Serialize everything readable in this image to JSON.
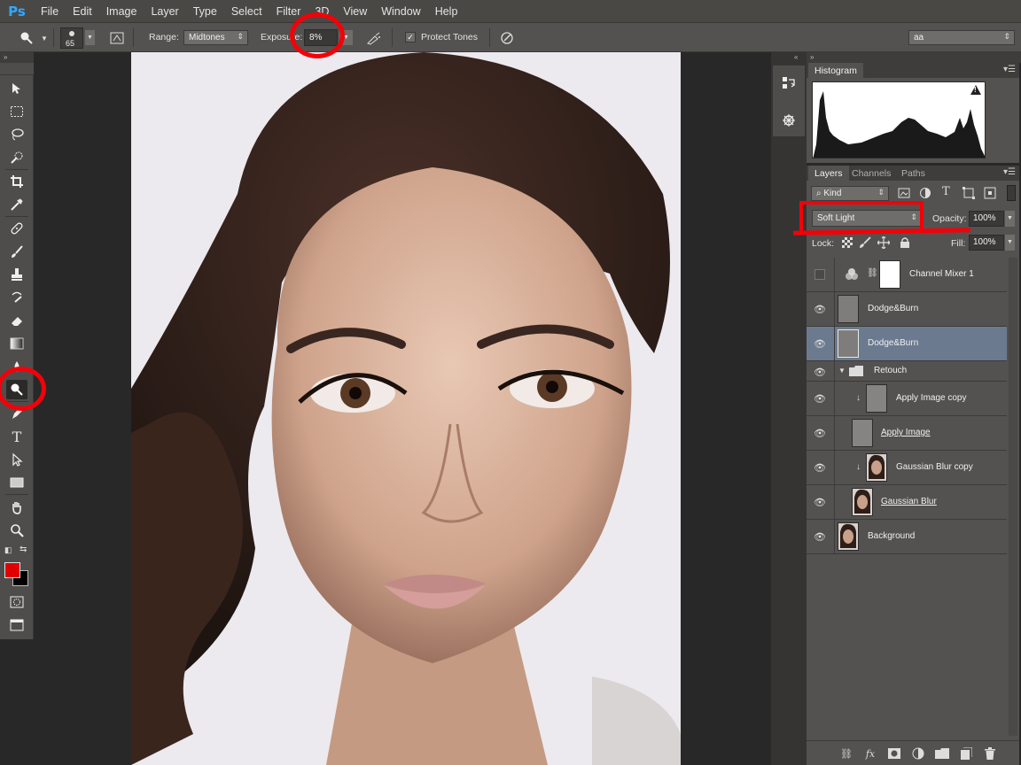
{
  "app": {
    "logo": "Ps"
  },
  "menu": [
    "File",
    "Edit",
    "Image",
    "Layer",
    "Type",
    "Select",
    "Filter",
    "3D",
    "View",
    "Window",
    "Help"
  ],
  "options": {
    "brush_size": "65",
    "range_label": "Range:",
    "range_value": "Midtones",
    "exposure_label": "Exposure:",
    "exposure_value": "8%",
    "protect_tones_label": "Protect Tones",
    "protect_tones_checked": true,
    "workspace_value": "aa"
  },
  "histogram": {
    "tab_label": "Histogram",
    "warning_glyph": "!"
  },
  "layers_panel": {
    "tabs": [
      "Layers",
      "Channels",
      "Paths"
    ],
    "kind_label": "Kind",
    "blend_mode": "Soft Light",
    "opacity_label": "Opacity:",
    "opacity_value": "100%",
    "lock_label": "Lock:",
    "fill_label": "Fill:",
    "fill_value": "100%",
    "layers": [
      {
        "name": "Channel Mixer 1",
        "visible": false,
        "type": "adjustment"
      },
      {
        "name": "Dodge&Burn",
        "visible": true,
        "type": "gray"
      },
      {
        "name": "Dodge&Burn",
        "visible": true,
        "type": "gray",
        "selected": true
      },
      {
        "name": "Retouch",
        "visible": true,
        "type": "group"
      },
      {
        "name": "Apply Image copy",
        "visible": true,
        "type": "gray",
        "clipped": true
      },
      {
        "name": "Apply Image",
        "visible": true,
        "type": "gray"
      },
      {
        "name": "Gaussian Blur copy",
        "visible": true,
        "type": "photo",
        "clipped": true
      },
      {
        "name": "Gaussian Blur",
        "visible": true,
        "type": "photo"
      },
      {
        "name": "Background",
        "visible": true,
        "type": "photo"
      }
    ]
  },
  "colors": {
    "foreground": "#e10000",
    "background": "#000000",
    "selected_layer": "#6b7a8e",
    "annotation": "#f40008"
  },
  "icons": {
    "toolbar": [
      "move-icon",
      "marquee-icon",
      "lasso-icon",
      "quick-select-icon",
      "crop-icon",
      "eyedropper-icon",
      "healing-brush-icon",
      "brush-icon",
      "clone-stamp-icon",
      "history-brush-icon",
      "eraser-icon",
      "gradient-icon",
      "blur-icon",
      "dodge-icon",
      "pen-icon",
      "type-icon",
      "path-select-icon",
      "rectangle-icon",
      "hand-icon",
      "zoom-icon"
    ]
  }
}
